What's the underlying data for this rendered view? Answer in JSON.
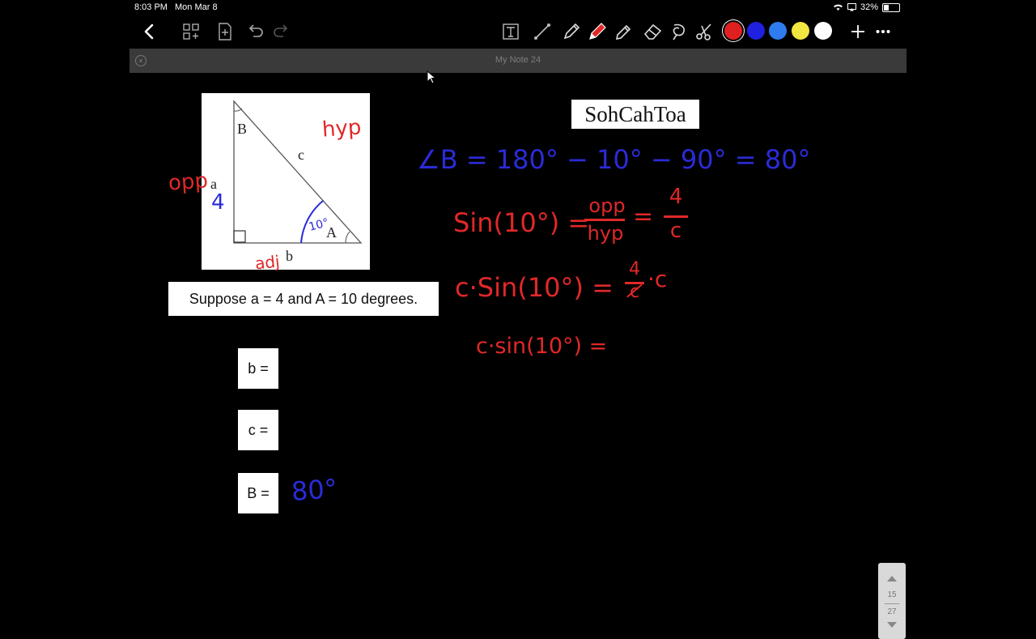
{
  "status": {
    "time": "8:03 PM",
    "date": "Mon Mar 8",
    "battery": "32%"
  },
  "toolbar": {
    "icons": [
      "back-icon",
      "grid-add-icon",
      "add-page-icon",
      "undo-icon",
      "redo-icon",
      "text-tool-icon",
      "line-tool-icon",
      "pen-icon",
      "pen-red-icon",
      "highlighter-icon",
      "eraser-icon",
      "lasso-icon",
      "scissors-icon",
      "add-icon",
      "more-icon"
    ],
    "colors": [
      "#e02020",
      "#2020e0",
      "#2f7cf0",
      "#f2e640",
      "#ffffff"
    ]
  },
  "note": {
    "title": "My Note 24"
  },
  "worksheet": {
    "labels": {
      "B": "B",
      "c": "c",
      "a": "a",
      "b": "b",
      "A": "A"
    },
    "prompt": "Suppose a = 4 and A = 10 degrees.",
    "answers": [
      {
        "label": "b ="
      },
      {
        "label": "c ="
      },
      {
        "label": "B ="
      }
    ],
    "mnemonic": "SohCahToa"
  },
  "ink": {
    "hyp": "hyp",
    "opp": "opp",
    "adj": "adj",
    "four": "4",
    "angle": "10°",
    "line1": "∠B = 180° − 10° − 90° = 80°",
    "line2_left": "Sin(10°) =",
    "line2_frac_top": "opp",
    "line2_frac_bot": "hyp",
    "line2_eq": "=",
    "line2_frac2_top": "4",
    "line2_frac2_bot": "c",
    "line3_left": "c·Sin(10°) =",
    "line3_frac_top": "4",
    "line3_frac_bot": "c",
    "line3_tail": "·c",
    "line4": "c·sin(10°) =",
    "answer_B": "80°"
  },
  "pager": {
    "current": "15",
    "total": "27"
  }
}
